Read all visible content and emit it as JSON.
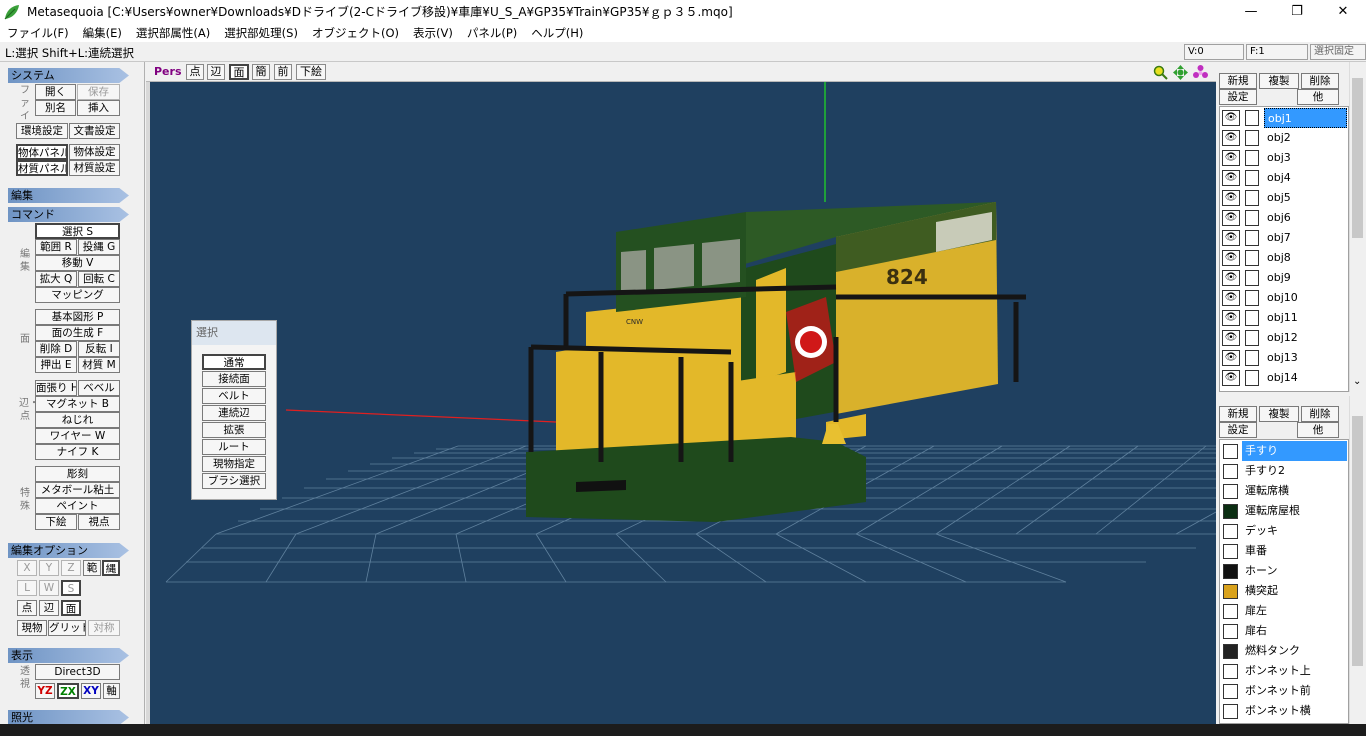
{
  "window": {
    "title": "Metasequoia [C:¥Users¥owner¥Downloads¥Dドライブ(2-Cドライブ移設)¥車庫¥U_S_A¥GP35¥Train¥GP35¥ｇｐ３５.mqo]",
    "minimize": "—",
    "maximize": "❐",
    "close": "✕"
  },
  "menu": [
    "ファイル(F)",
    "編集(E)",
    "選択部属性(A)",
    "選択部処理(S)",
    "オブジェクト(O)",
    "表示(V)",
    "パネル(P)",
    "ヘルプ(H)"
  ],
  "status": {
    "hint": "L:選択  Shift+L:連続選択",
    "v": "V:0",
    "f": "F:1",
    "lock": "選択固定"
  },
  "left": {
    "system": "システム",
    "file_label": "ファイル",
    "open": "開く",
    "save": "保存",
    "save_as": "別名",
    "insert": "挿入",
    "env_settings": "環境設定",
    "doc_settings": "文書設定",
    "obj_panel": "物体パネル",
    "obj_settings": "物体設定",
    "mat_panel": "材質パネル",
    "mat_settings": "材質設定",
    "edit": "編集",
    "command": "コマンド",
    "edit_label": "編集",
    "select": "選択 S",
    "range": "範囲 R",
    "lasso": "投縄 G",
    "move": "移動 V",
    "scale": "拡大 Q",
    "rotate": "回転 C",
    "mapping": "マッピング",
    "face_label": "面",
    "primitive": "基本図形 P",
    "face_gen": "面の生成 F",
    "delete": "削除 D",
    "flip": "反転 I",
    "extrude": "押出 E",
    "material": "材質 M",
    "edge_label": "辺・点",
    "stretch": "面張り H",
    "bevel": "ベベル",
    "magnet": "マグネット B",
    "twist": "ねじれ",
    "wire": "ワイヤー W",
    "knife": "ナイフ K",
    "special_label": "特殊",
    "carve": "彫刻",
    "metaball": "メタボール粘土",
    "paint": "ペイント",
    "underlay": "下絵",
    "viewpoint": "視点",
    "edit_options": "編集オプション",
    "x": "X",
    "y": "Y",
    "z": "Z",
    "opt_range": "範",
    "opt_lasso": "縄",
    "l": "L",
    "w": "W",
    "s": "S",
    "point": "点",
    "edge": "辺",
    "face": "面",
    "current": "現物",
    "grid": "グリッド",
    "symmetry": "対称",
    "display": "表示",
    "display_label": "透視",
    "direct3d": "Direct3D",
    "yz": "YZ",
    "zx": "ZX",
    "xy": "XY",
    "axis": "軸",
    "lighting": "照光"
  },
  "viewport": {
    "pers": "Pers",
    "point": "点",
    "edge": "辺",
    "face": "面",
    "simple": "簡",
    "front": "前",
    "underlay": "下絵",
    "zoom_icon": "magnifier-icon",
    "pan_icon": "pan-icon",
    "rotate_icon": "rotate-icon",
    "cab_number": "824",
    "cab_logo": "CNW"
  },
  "select_panel": {
    "title": "選択",
    "items": [
      "通常",
      "接続面",
      "ベルト",
      "連続辺",
      "拡張",
      "ルート",
      "現物指定",
      "ブラシ選択"
    ]
  },
  "objects": {
    "new": "新規",
    "copy": "複製",
    "delete": "削除",
    "settings": "設定",
    "other": "他",
    "items": [
      "obj1",
      "obj2",
      "obj3",
      "obj4",
      "obj5",
      "obj6",
      "obj7",
      "obj8",
      "obj9",
      "obj10",
      "obj11",
      "obj12",
      "obj13",
      "obj14"
    ],
    "selected": "obj1"
  },
  "materials": {
    "new": "新規",
    "copy": "複製",
    "delete": "削除",
    "settings": "設定",
    "other": "他",
    "items": [
      {
        "name": "手すり",
        "color": "#ffffff"
      },
      {
        "name": "手すり2",
        "color": "#ffffff"
      },
      {
        "name": "運転席横",
        "color": "#ffffff"
      },
      {
        "name": "運転席屋根",
        "color": "#0b2e12"
      },
      {
        "name": "デッキ",
        "color": "#ffffff"
      },
      {
        "name": "車番",
        "color": "#ffffff"
      },
      {
        "name": "ホーン",
        "color": "#111111"
      },
      {
        "name": "横突起",
        "color": "#d9a21c"
      },
      {
        "name": "扉左",
        "color": "#ffffff"
      },
      {
        "name": "扉右",
        "color": "#ffffff"
      },
      {
        "name": "燃料タンク",
        "color": "#222222"
      },
      {
        "name": "ボンネット上",
        "color": "#ffffff"
      },
      {
        "name": "ボンネット前",
        "color": "#ffffff"
      },
      {
        "name": "ボンネット横",
        "color": "#ffffff"
      }
    ],
    "selected": "手すり"
  },
  "colors": {
    "viewport_bg": "#1f4060",
    "selection": "#3399ff",
    "section_header": "#6f94c4"
  }
}
